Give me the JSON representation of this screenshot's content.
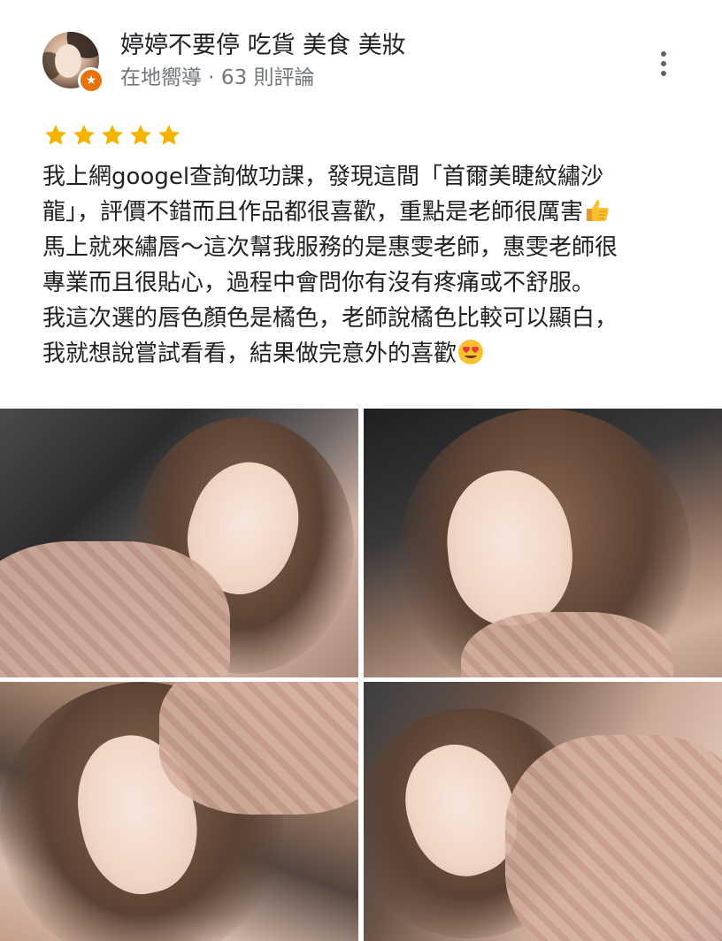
{
  "reviewer": {
    "name": "婷婷不要停 吃貨 美食 美妝",
    "meta": "在地嚮導 · 63 則評論",
    "avatar_icon": "profile-avatar",
    "badge_icon": "local-guide-star-icon"
  },
  "menu_icon": "more-vert-icon",
  "rating": {
    "stars": 5,
    "max": 5,
    "star_color": "#f4b400"
  },
  "review": {
    "lines": [
      "我上網googel查詢做功課，發現這間「首爾美睫紋繡沙",
      "龍」，評價不錯而且作品都很喜歡，重點是老師很厲害",
      "馬上就來繡唇～這次幫我服務的是惠雯老師，惠雯老師很",
      "專業而且很貼心，過程中會問你有沒有疼痛或不舒服。",
      "我這次選的唇色顏色是橘色，老師說橘色比較可以顯白，",
      "我就想說嘗試看看，結果做完意外的喜歡"
    ],
    "emojis": [
      "thumbs-up-emoji",
      "heart-eyes-emoji"
    ]
  },
  "photos": [
    {
      "name": "review-photo-1"
    },
    {
      "name": "review-photo-2"
    },
    {
      "name": "review-photo-3"
    },
    {
      "name": "review-photo-4"
    }
  ]
}
